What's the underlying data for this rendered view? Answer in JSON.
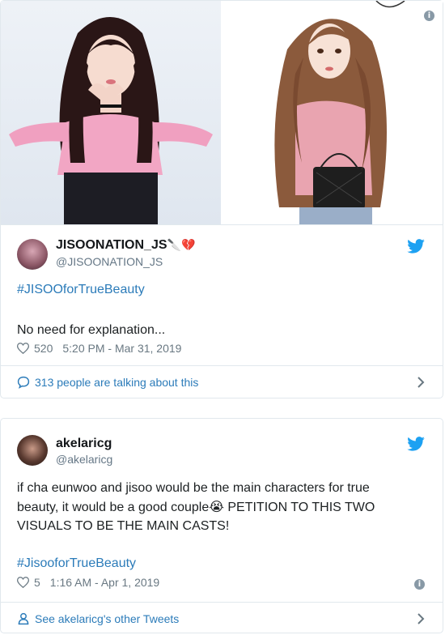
{
  "tweet1": {
    "display_name": "JISOONATION_JS",
    "name_emoji": "🔪💔",
    "screen_name": "@JISOONATION_JS",
    "hashtag": "#JISOOforTrueBeauty",
    "text": "No need for explanation...",
    "likes": "520",
    "timestamp": "5:20 PM - Mar 31, 2019",
    "footer_label": "313 people are talking about this"
  },
  "tweet2": {
    "display_name": "akelaricg",
    "screen_name": "@akelaricg",
    "text_part1": "if cha eunwoo and jisoo would be the main characters for true beauty, it would be a good couple",
    "emoji": "😭",
    "text_part2": " PETITION TO THIS TWO VISUALS TO BE THE MAIN CASTS!",
    "hashtag": "#JisooforTrueBeauty",
    "likes": "5",
    "timestamp": "1:16 AM - Apr 1, 2019",
    "footer_label": "See akelaricg's other Tweets"
  },
  "colors": {
    "link": "#2b7bb9",
    "twitter_blue": "#1da1f2",
    "muted": "#697882",
    "border": "#e1e8ed"
  },
  "icons": {
    "info": "i",
    "chevron": "chevron-right-icon",
    "bird": "twitter-bird-icon",
    "heart": "heart-outline-icon"
  }
}
